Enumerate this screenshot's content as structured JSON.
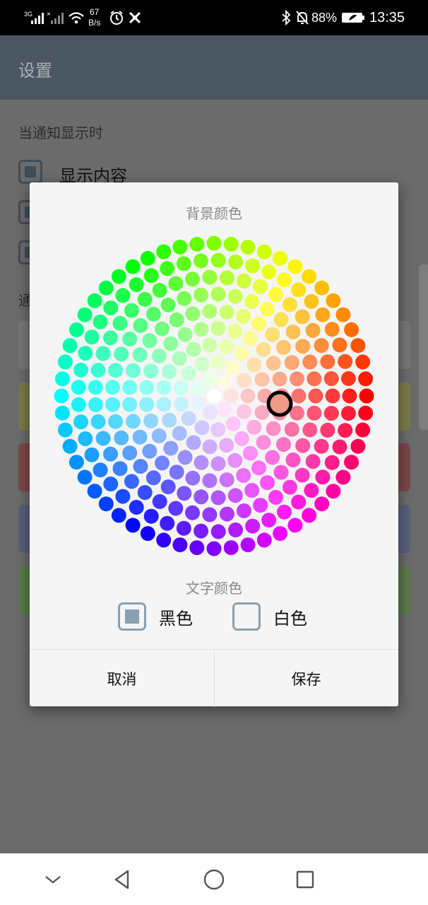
{
  "status_bar": {
    "network": "3G",
    "network_r": "R",
    "speed_value": "67",
    "speed_unit": "B/s",
    "battery": "88%",
    "time": "13:35"
  },
  "app_bar": {
    "title": "设置"
  },
  "background": {
    "section_label": "当通知显示时",
    "checkbox_label": "显示内容",
    "section_label_2": "通",
    "swatch_colors": [
      "#777777",
      "#7a7a4a",
      "#7a4848",
      "#56607a",
      "#5a7a4a"
    ]
  },
  "dialog": {
    "title": "背景颜色",
    "text_color_title": "文字颜色",
    "options": {
      "black": "黑色",
      "white": "白色"
    },
    "selected_text_color": "black",
    "selected_bg_color": "#ef9a86",
    "cancel": "取消",
    "save": "保存"
  },
  "nav_bar": {
    "icons": [
      "chevron-down-icon",
      "back-icon",
      "home-icon",
      "recents-icon"
    ]
  }
}
